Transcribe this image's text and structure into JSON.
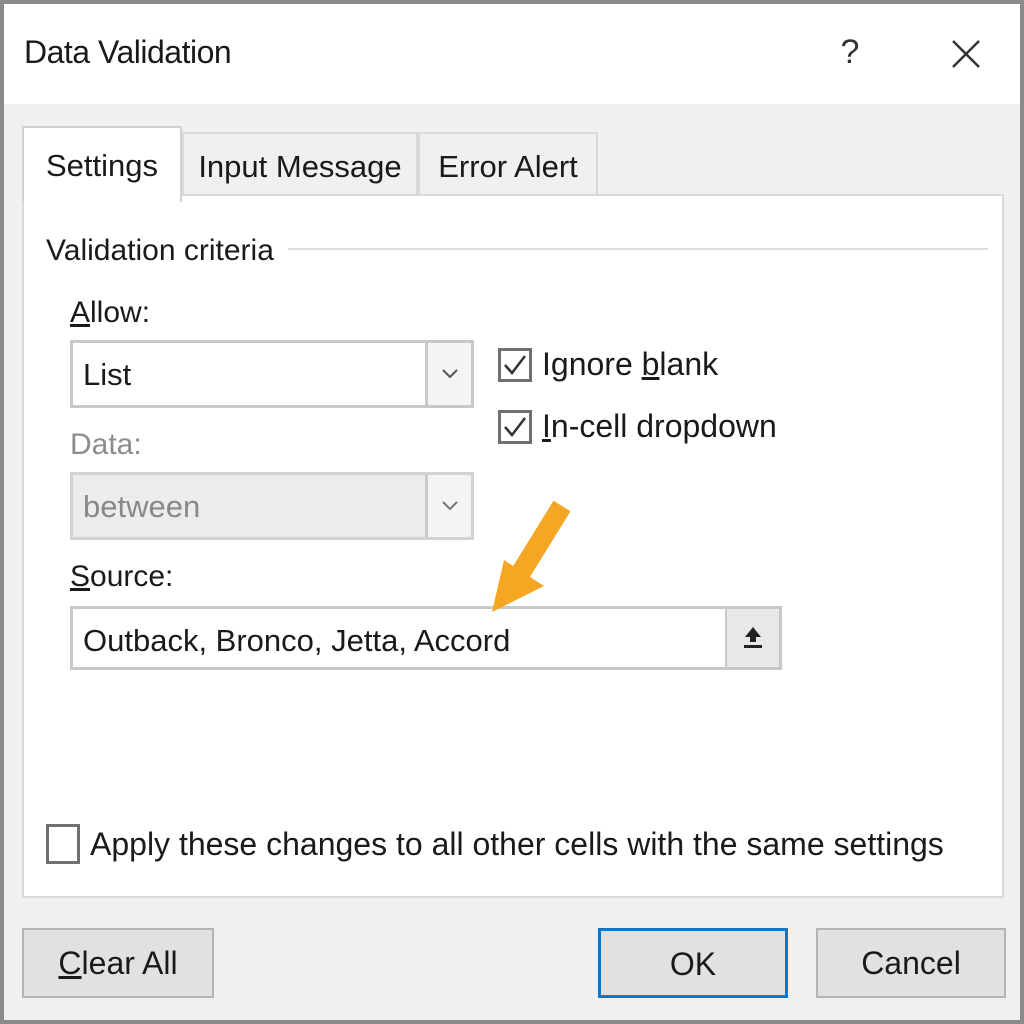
{
  "window": {
    "title": "Data Validation",
    "help_label": "?"
  },
  "tabs": [
    {
      "label": "Settings",
      "active": true
    },
    {
      "label": "Input Message",
      "active": false
    },
    {
      "label": "Error Alert",
      "active": false
    }
  ],
  "settings": {
    "section_title": "Validation criteria",
    "allow": {
      "label_accel": "A",
      "label_rest": "llow:",
      "value": "List"
    },
    "data": {
      "label": "Data:",
      "value": "between",
      "enabled": false
    },
    "ignore_blank": {
      "label_pre": "Ignore ",
      "label_accel": "b",
      "label_post": "lank",
      "checked": true
    },
    "in_cell_dropdown": {
      "label_accel": "I",
      "label_rest": "n-cell dropdown",
      "checked": true
    },
    "source": {
      "label_accel": "S",
      "label_rest": "ource:",
      "value": "Outback, Bronco, Jetta, Accord"
    },
    "apply_all": {
      "label": "Apply these changes to all other cells with the same settings",
      "checked": false
    }
  },
  "buttons": {
    "clear_all_accel": "C",
    "clear_all_rest": "lear All",
    "ok": "OK",
    "cancel": "Cancel"
  },
  "colors": {
    "annotation_arrow": "#f5a623",
    "default_button_border": "#0078d7"
  }
}
